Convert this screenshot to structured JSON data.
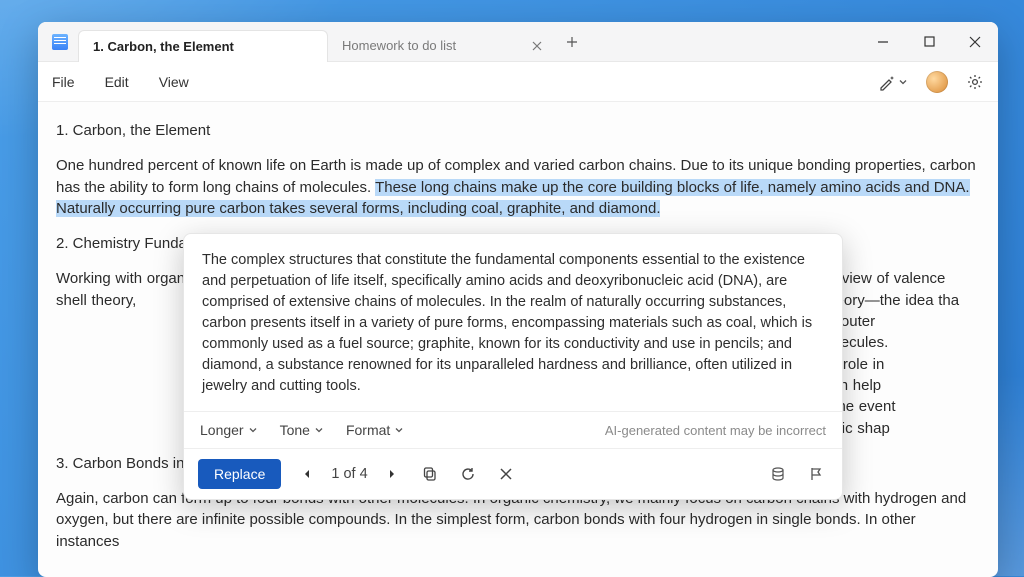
{
  "tabs": {
    "active_title": "1. Carbon, the Element",
    "inactive_title": "Homework to do list"
  },
  "menu": {
    "file": "File",
    "edit": "Edit",
    "view": "View"
  },
  "document": {
    "heading1": "1. Carbon, the Element",
    "para1_a": "One hundred percent of known life on Earth is made up of complex and varied carbon chains. Due to its unique bonding properties, carbon has the ability to form long chains of molecules. ",
    "para1_highlight": "These long chains make up the core building blocks of life, namely amino acids and DNA. Naturally occurring pure carbon takes several forms, including coal, graphite, and diamond.",
    "heading2": "2. Chemistry Fundam",
    "para2_a": "Working with organi",
    "para2_b": "de a brief review of valence shell theory,",
    "para2_c": "ound valence shell theory—the idea tha",
    "para2_d": "e to the four electrons in its outer",
    "para2_e": "onds with other atoms or molecules.",
    "para2_f": "is dot structures play a pivotal role in",
    "para2_g": "ing resonant structures) can help",
    "para2_h": "rbital shells can help illuminate the event",
    "para2_i": "ise a molecule can tell us its basic shap",
    "heading3": "3. Carbon Bonds in C",
    "para3": "Again, carbon can form up to four bonds with other molecules. In organic chemistry, we mainly focus on carbon chains with hydrogen and oxygen, but there are infinite possible compounds. In the simplest form, carbon bonds with four hydrogen in single bonds. In other instances"
  },
  "popup": {
    "text": "The complex structures that constitute the fundamental components essential to the existence and perpetuation of life itself, specifically amino acids and deoxyribonucleic acid (DNA), are comprised of extensive chains of molecules. In the realm of naturally occurring substances, carbon presents itself in a variety of pure forms, encompassing materials such as coal, which is commonly used as a fuel source; graphite, known for its conductivity and use in pencils; and diamond, a substance renowned for its unparalleled hardness and brilliance, often utilized in jewelry and cutting tools.",
    "options": {
      "longer": "Longer",
      "tone": "Tone",
      "format": "Format"
    },
    "disclaimer": "AI-generated content may be incorrect",
    "replace": "Replace",
    "pager": "1 of 4"
  }
}
